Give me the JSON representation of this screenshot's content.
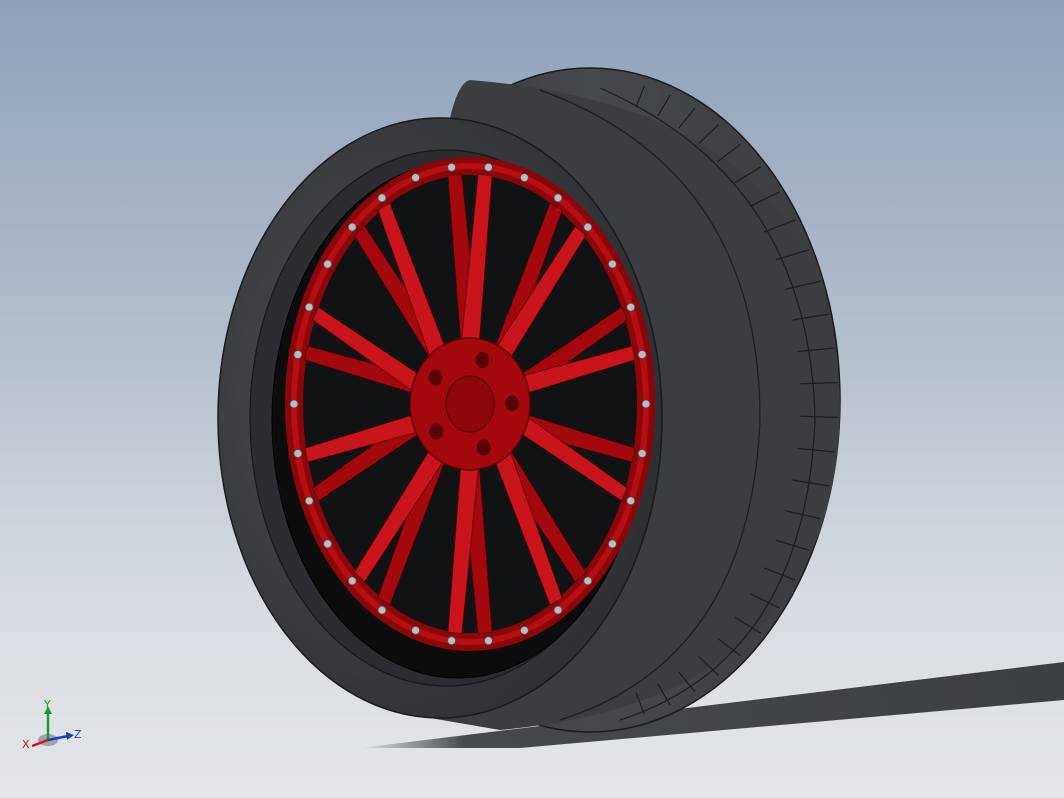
{
  "viewport": {
    "background_top": "#8fa1b8",
    "background_bottom": "#e4e6e9"
  },
  "model": {
    "tire_color": "#3a3c40",
    "tire_highlight": "#55585d",
    "wheel_color": "#a3080c",
    "wheel_highlight": "#c8141a",
    "barrel_color": "#0c0c0d",
    "bolt_color": "#b9bcc0"
  },
  "triad": {
    "x_label": "X",
    "y_label": "Y",
    "z_label": "Z",
    "x_color": "#d2141c",
    "y_color": "#1f9a2a",
    "z_color": "#1b3fb8"
  }
}
